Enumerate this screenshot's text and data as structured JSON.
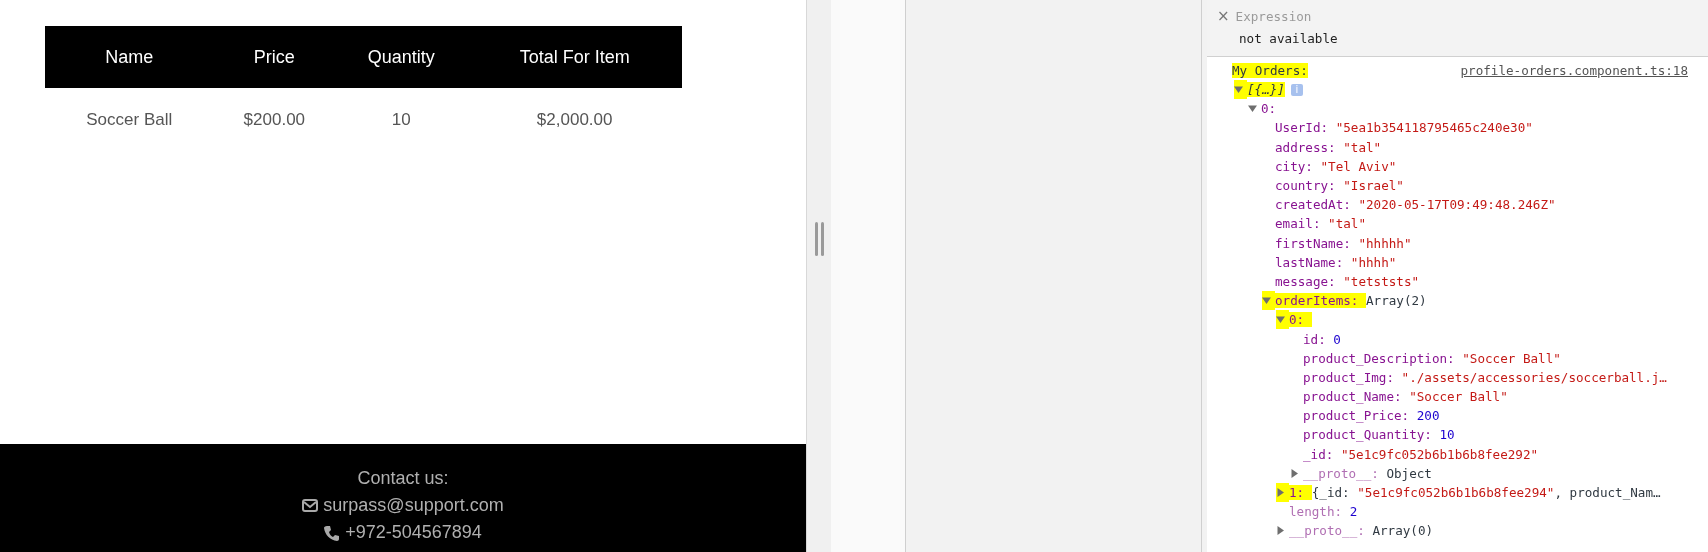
{
  "page": {
    "table": {
      "columns": [
        "Name",
        "Price",
        "Quantity",
        "Total For Item"
      ],
      "rows": [
        [
          "Soccer Ball",
          "$200.00",
          "10",
          "$2,000.00"
        ]
      ]
    },
    "footer": {
      "heading": "Contact us:",
      "email": "surpass@support.com",
      "phone": "+972-504567894"
    }
  },
  "console": {
    "expression": {
      "close": "×",
      "label": "Expression",
      "value": "not available"
    },
    "log": {
      "message": "My Orders:",
      "highlighted": true,
      "source": "profile-orders.component.ts:18",
      "tree": [
        {
          "value": "[{…}]",
          "kind": "preview",
          "badge": "i",
          "expanded": true,
          "highlighted": true,
          "children": [
            {
              "key": "0:",
              "expanded": true,
              "highlighted": false,
              "children": [
                {
                  "key": "UserId:",
                  "value": "\"5ea1b354118795465c240e30\"",
                  "kind": "string"
                },
                {
                  "key": "address:",
                  "value": "\"tal\"",
                  "kind": "string"
                },
                {
                  "key": "city:",
                  "value": "\"Tel Aviv\"",
                  "kind": "string"
                },
                {
                  "key": "country:",
                  "value": "\"Israel\"",
                  "kind": "string"
                },
                {
                  "key": "createdAt:",
                  "value": "\"2020-05-17T09:49:48.246Z\"",
                  "kind": "string"
                },
                {
                  "key": "email:",
                  "value": "\"tal\"",
                  "kind": "string"
                },
                {
                  "key": "firstName:",
                  "value": "\"hhhhh\"",
                  "kind": "string"
                },
                {
                  "key": "lastName:",
                  "value": "\"hhhh\"",
                  "kind": "string"
                },
                {
                  "key": "message:",
                  "value": "\"tetststs\"",
                  "kind": "string"
                },
                {
                  "key": "orderItems:",
                  "value": "Array(2)",
                  "kind": "object",
                  "expanded": true,
                  "highlighted": true,
                  "children": [
                    {
                      "key": "0:",
                      "expanded": true,
                      "highlighted": true,
                      "children": [
                        {
                          "key": "id:",
                          "value": "0",
                          "kind": "number"
                        },
                        {
                          "key": "product_Description:",
                          "value": "\"Soccer Ball\"",
                          "kind": "string"
                        },
                        {
                          "key": "product_Img:",
                          "value": "\"./assets/accessories/soccerball.j…",
                          "kind": "string"
                        },
                        {
                          "key": "product_Name:",
                          "value": "\"Soccer Ball\"",
                          "kind": "string"
                        },
                        {
                          "key": "product_Price:",
                          "value": "200",
                          "kind": "number"
                        },
                        {
                          "key": "product_Quantity:",
                          "value": "10",
                          "kind": "number"
                        },
                        {
                          "key": "_id:",
                          "value": "\"5e1c9fc052b6b1b6b8fee292\"",
                          "kind": "string"
                        },
                        {
                          "key": "__proto__:",
                          "value": "Object",
                          "kind": "object",
                          "expanded": false,
                          "dim": true
                        }
                      ]
                    },
                    {
                      "key": "1:",
                      "expanded": false,
                      "highlighted": true,
                      "parts": [
                        {
                          "text": "{_id: ",
                          "kind": "plain"
                        },
                        {
                          "text": "\"5e1c9fc052b6b1b6b8fee294\"",
                          "kind": "string"
                        },
                        {
                          "text": ", product_Nam…",
                          "kind": "plain"
                        }
                      ]
                    },
                    {
                      "key": "length:",
                      "value": "2",
                      "kind": "number",
                      "dim": true
                    },
                    {
                      "key": "__proto__:",
                      "value": "Array(0)",
                      "kind": "object",
                      "expanded": false,
                      "dim": true
                    }
                  ]
                }
              ]
            }
          ]
        }
      ]
    }
  }
}
